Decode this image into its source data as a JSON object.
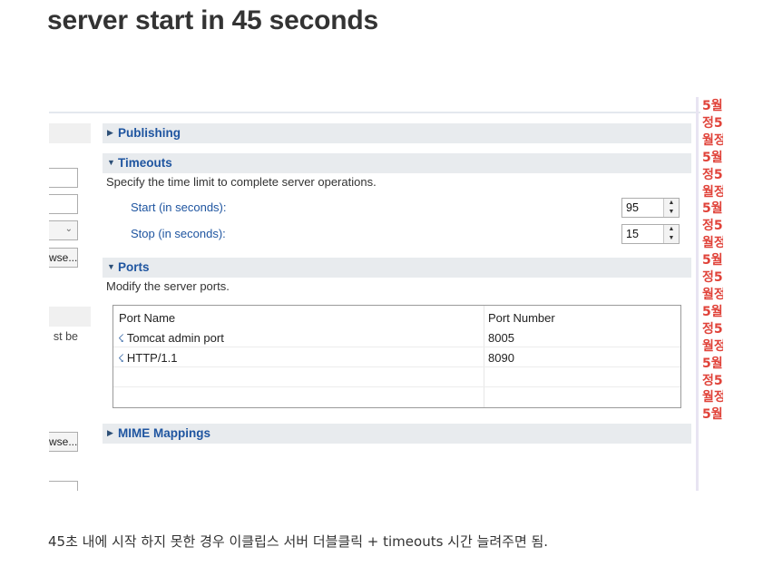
{
  "page": {
    "title": "server start in 45 seconds",
    "caption": "45초 내에 시작 하지 못한 경우 이클립스 서버 더블클릭 + timeouts 시간 늘려주면 됨."
  },
  "editor": {
    "left_partial": {
      "browse_label_1": "wse...",
      "browse_label_2": "wse...",
      "text_fragment": "st be"
    },
    "sections": {
      "publishing": {
        "label": "Publishing",
        "expanded": false
      },
      "timeouts": {
        "label": "Timeouts",
        "expanded": true,
        "description": "Specify the time limit to complete server operations.",
        "start_label": "Start (in seconds):",
        "start_value": "95",
        "stop_label": "Stop (in seconds):",
        "stop_value": "15"
      },
      "ports": {
        "label": "Ports",
        "expanded": true,
        "description": "Modify the server ports.",
        "columns": [
          "Port Name",
          "Port Number"
        ],
        "rows": [
          {
            "name": "Tomcat admin port",
            "number": "8005"
          },
          {
            "name": "HTTP/1.1",
            "number": "8090"
          }
        ]
      },
      "mime": {
        "label": "MIME Mappings",
        "expanded": false
      }
    }
  },
  "sidebar_snippet": {
    "text": "5월정5월정5월정5월정5월정5월정5월정5월정5월정5월정5월정5월정5월"
  },
  "colors": {
    "link_blue": "#1f55a0",
    "section_bg": "#e8ebee",
    "sidebar_red": "#e0433a"
  },
  "icons": {
    "collapsed": "chevron-right-icon",
    "expanded": "chevron-down-icon",
    "port": "network-port-icon"
  }
}
